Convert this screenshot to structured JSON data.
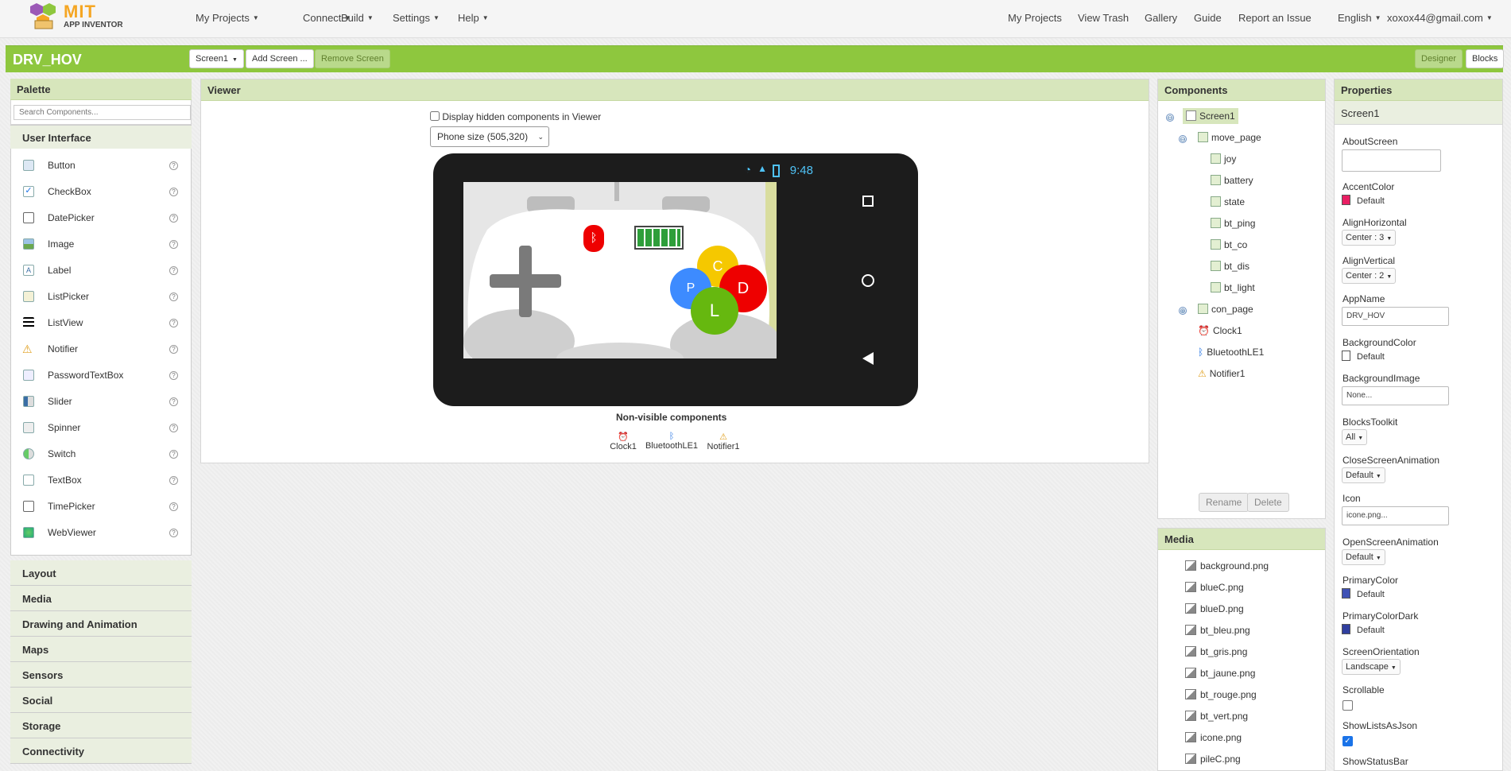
{
  "nav": {
    "logo_line1": "MIT",
    "logo_line2": "APP INVENTOR",
    "left_menu": [
      "My Projects",
      "Connect",
      "Build",
      "Settings",
      "Help"
    ],
    "right_links": [
      "My Projects",
      "View Trash",
      "Gallery",
      "Guide",
      "Report an Issue"
    ],
    "language": "English",
    "account": "xoxox44@gmail.com"
  },
  "toolbar": {
    "project_name": "DRV_HOV",
    "screen_select": "Screen1",
    "add_screen": "Add Screen ...",
    "remove_screen": "Remove Screen",
    "designer": "Designer",
    "blocks": "Blocks"
  },
  "palette": {
    "title": "Palette",
    "search_placeholder": "Search Components...",
    "open_category": "User Interface",
    "items": [
      "Button",
      "CheckBox",
      "DatePicker",
      "Image",
      "Label",
      "ListPicker",
      "ListView",
      "Notifier",
      "PasswordTextBox",
      "Slider",
      "Spinner",
      "Switch",
      "TextBox",
      "TimePicker",
      "WebViewer"
    ],
    "help_glyph": "?",
    "categories": [
      "Layout",
      "Media",
      "Drawing and Animation",
      "Maps",
      "Sensors",
      "Social",
      "Storage",
      "Connectivity"
    ]
  },
  "viewer": {
    "title": "Viewer",
    "hidden_label": "Display hidden components in Viewer",
    "phone_size": "Phone size (505,320)",
    "clock": "9:48",
    "buttons": {
      "c": "C",
      "p": "P",
      "d": "D",
      "l": "L"
    },
    "nonvisible_title": "Non-visible components",
    "nonvisible": [
      "Clock1",
      "BluetoothLE1",
      "Notifier1"
    ]
  },
  "components": {
    "title": "Components",
    "tree": {
      "screen": "Screen1",
      "move_page": "move_page",
      "move_children": [
        "joy",
        "battery",
        "state",
        "bt_ping",
        "bt_co",
        "bt_dis",
        "bt_light"
      ],
      "con_page": "con_page",
      "others": [
        "Clock1",
        "BluetoothLE1",
        "Notifier1"
      ]
    },
    "rename": "Rename",
    "delete": "Delete",
    "collapse_glyph": "⊖",
    "expand_glyph": "⊕"
  },
  "media": {
    "title": "Media",
    "files": [
      "background.png",
      "blueC.png",
      "blueD.png",
      "bt_bleu.png",
      "bt_gris.png",
      "bt_jaune.png",
      "bt_rouge.png",
      "bt_vert.png",
      "icone.png",
      "pileC.png"
    ]
  },
  "properties": {
    "title": "Properties",
    "component": "Screen1",
    "labels": {
      "about": "AboutScreen",
      "accent": "AccentColor",
      "align_h": "AlignHorizontal",
      "align_v": "AlignVertical",
      "appname": "AppName",
      "bgcolor": "BackgroundColor",
      "bgimage": "BackgroundImage",
      "toolkit": "BlocksToolkit",
      "close_anim": "CloseScreenAnimation",
      "icon": "Icon",
      "open_anim": "OpenScreenAnimation",
      "primary": "PrimaryColor",
      "primary_dark": "PrimaryColorDark",
      "orientation": "ScreenOrientation",
      "scrollable": "Scrollable",
      "lists_json": "ShowListsAsJson",
      "statusbar": "ShowStatusBar"
    },
    "values": {
      "accent": "Default",
      "align_h": "Center : 3",
      "align_v": "Center : 2",
      "appname": "DRV_HOV",
      "bgcolor": "Default",
      "bgimage": "None...",
      "toolkit": "All",
      "close_anim": "Default",
      "icon": "icone.png...",
      "open_anim": "Default",
      "primary": "Default",
      "primary_dark": "Default",
      "orientation": "Landscape",
      "scrollable": false,
      "lists_json": true
    },
    "colors": {
      "accent": "#e91e63",
      "bgcolor": "#ffffff",
      "primary": "#3f51b5",
      "primary_dark": "#303f9f"
    }
  },
  "theme": {
    "green": "#8ec73e",
    "panel_head": "#d7e6bc"
  }
}
